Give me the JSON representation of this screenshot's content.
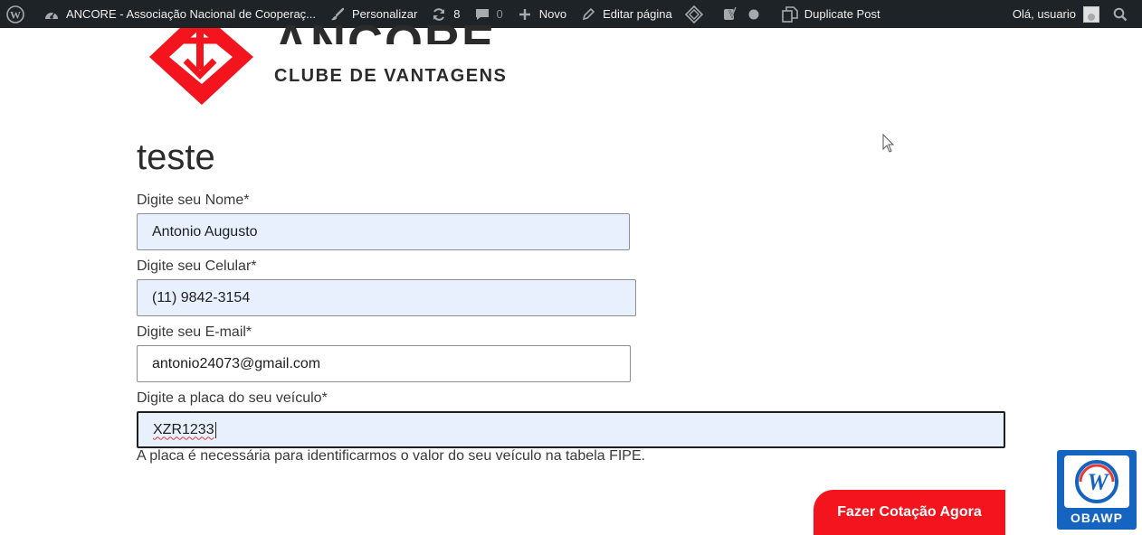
{
  "adminbar": {
    "site_name": "ANCORE - Associação Nacional de Cooperaç...",
    "customize": "Personalizar",
    "updates_count": "8",
    "comments_count": "0",
    "new": "Novo",
    "edit_page": "Editar página",
    "duplicate_post": "Duplicate Post",
    "greeting": "Olá, usuario"
  },
  "logo": {
    "title": "ANCORE",
    "subtitle": "CLUBE DE VANTAGENS",
    "brand_color": "#f4141e"
  },
  "form": {
    "title": "teste",
    "fields": [
      {
        "label": "Digite seu Nome*",
        "value": "Antonio Augusto"
      },
      {
        "label": "Digite seu Celular*",
        "value": "(11) 9842-3154"
      },
      {
        "label": "Digite seu E-mail*",
        "value": "antonio24073@gmail.com"
      },
      {
        "label": "Digite a placa do seu veículo*",
        "value": "XZR1233"
      }
    ],
    "hint": "A placa é necessária para identificarmos o valor do seu veículo na tabela FIPE.",
    "submit_label": "Fazer Cotação Agora"
  },
  "badge": {
    "text": "OBAWP",
    "color": "#1565c0"
  }
}
